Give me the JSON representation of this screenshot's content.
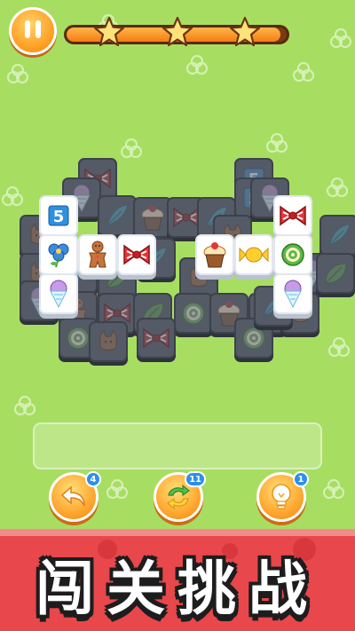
{
  "hud": {
    "stars_earned": 3,
    "stars_total": 3,
    "progress": 0.97,
    "icons": {
      "pause": "pause-icon",
      "star": "star-icon"
    }
  },
  "board": {
    "tile_icons": [
      "gingerbread-man",
      "red-bow",
      "cupcake",
      "wrapped-candy",
      "swiss-roll",
      "blue-flower",
      "shaved-ice-cone",
      "number-5-block",
      "blue-feather",
      "green-leaf",
      "gingerbread-cat"
    ]
  },
  "powerups": {
    "undo": {
      "count": "4",
      "icon": "undo-arrow-icon"
    },
    "shuffle": {
      "count": "11",
      "icon": "shuffle-icon"
    },
    "hint": {
      "count": "1",
      "icon": "lightbulb-icon"
    }
  },
  "banner": {
    "title": "闯关挑战"
  },
  "colors": {
    "background": "#a7de62",
    "banner": "#e8474b",
    "accent": "#ff9a1e"
  }
}
